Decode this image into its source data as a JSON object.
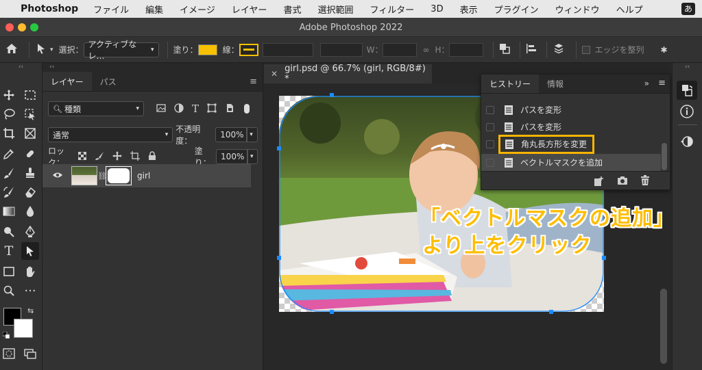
{
  "menubar": {
    "app_name": "Photoshop",
    "items": [
      "ファイル",
      "編集",
      "イメージ",
      "レイヤー",
      "書式",
      "選択範囲",
      "フィルター",
      "3D",
      "表示",
      "プラグイン",
      "ウィンドウ",
      "ヘルプ"
    ],
    "input_method": "あ"
  },
  "window": {
    "title": "Adobe Photoshop 2022"
  },
  "options": {
    "select_label": "選択：",
    "select_value": "アクティブなレ…",
    "fill_label": "塗り：",
    "stroke_label": "線：",
    "w_label": "W：",
    "h_label": "H：",
    "align_edges_label": "エッジを整列",
    "fill_color": "#f7c000"
  },
  "layers_panel": {
    "tabs": [
      "レイヤー",
      "パス"
    ],
    "filter_value": "種類",
    "blend_mode": "通常",
    "opacity_label": "不透明度：",
    "opacity_value": "100%",
    "lock_label": "ロック：",
    "fill_label": "塗り：",
    "fill_value": "100%",
    "layer_name": "girl"
  },
  "document": {
    "tab_title": "girl.psd @ 66.7% (girl, RGB/8#) *"
  },
  "history_panel": {
    "tabs": [
      "ヒストリー",
      "情報"
    ],
    "items": [
      {
        "label": "パスを変形"
      },
      {
        "label": "パスを変形"
      },
      {
        "label": "角丸長方形を変更"
      },
      {
        "label": "ベクトルマスクを追加"
      }
    ],
    "highlight_color": "#f7b500"
  },
  "annotation": {
    "line1": "「ベクトルマスクの追加」",
    "line2": "より上をクリック",
    "color": "#ffbd00"
  }
}
